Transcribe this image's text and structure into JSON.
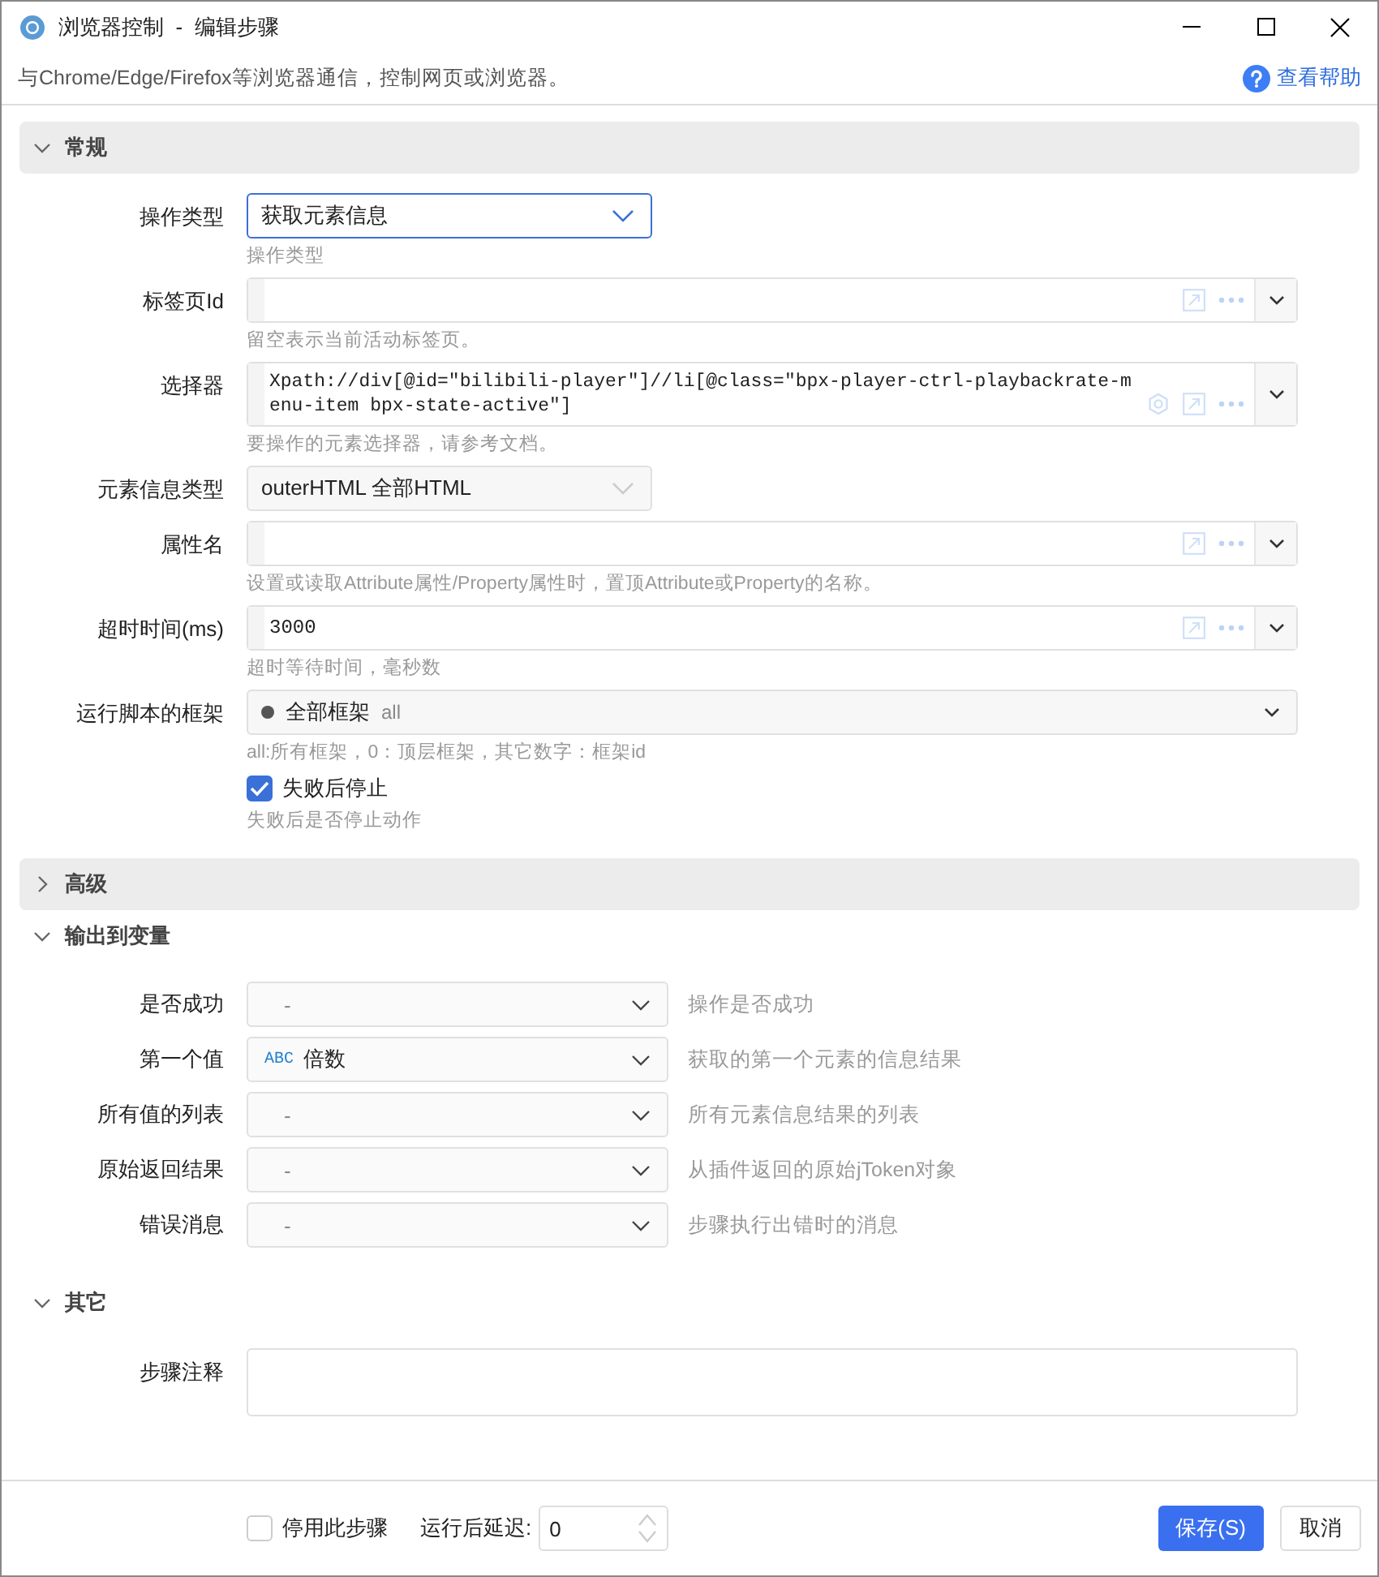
{
  "window": {
    "title": "浏览器控制  -  编辑步骤"
  },
  "description": "与Chrome/Edge/Firefox等浏览器通信，控制网页或浏览器。",
  "help_link": "查看帮助",
  "sections": [
    {
      "title": "常规",
      "kind": "panel",
      "expanded": true,
      "fields": [
        {
          "kind": "select",
          "label": "操作类型",
          "value": "获取元素信息",
          "focused": true,
          "hint": "操作类型"
        },
        {
          "kind": "combo",
          "label": "标签页Id",
          "picker": false,
          "hint": "留空表示当前活动标签页。"
        },
        {
          "kind": "combo",
          "label": "选择器",
          "value": "Xpath://div[@id=\"bilibili-player\"]//li[@class=\"bpx-player-ctrl-playbackrate-menu-item bpx-state-active\"]",
          "picker": true,
          "hint": "要操作的元素选择器，请参考文档。"
        },
        {
          "kind": "select",
          "label": "元素信息类型",
          "value": "outerHTML 全部HTML",
          "focused": false
        },
        {
          "kind": "combo",
          "label": "属性名",
          "picker": false,
          "hint": "设置或读取Attribute属性/Property属性时，置顶Attribute或Property的名称。"
        },
        {
          "kind": "combo",
          "label": "超时时间(ms)",
          "value": "3000",
          "picker": false,
          "hint": "超时等待时间，毫秒数"
        },
        {
          "kind": "frame",
          "label": "运行脚本的框架",
          "value": "全部框架",
          "detail": "all",
          "hint": "all:所有框架，0：顶层框架，其它数字：框架id"
        },
        {
          "kind": "checkbox",
          "label": "失败后停止",
          "checked": true,
          "hint": "失败后是否停止动作"
        }
      ]
    },
    {
      "title": "高级",
      "kind": "panel",
      "expanded": false
    },
    {
      "title": "输出到变量",
      "kind": "plain",
      "expanded": true,
      "outputs": [
        {
          "label": "是否成功",
          "value": "-",
          "hint": "操作是否成功"
        },
        {
          "label": "第一个值",
          "type_badge": "ABC",
          "value": "倍数",
          "hint": "获取的第一个元素的信息结果"
        },
        {
          "label": "所有值的列表",
          "value": "-",
          "hint": "所有元素信息结果的列表"
        },
        {
          "label": "原始返回结果",
          "value": "-",
          "hint": "从插件返回的原始jToken对象"
        },
        {
          "label": "错误消息",
          "value": "-",
          "hint": "步骤执行出错时的消息"
        }
      ]
    },
    {
      "title": "其它",
      "kind": "plain",
      "expanded": true,
      "fields": [
        {
          "kind": "textarea",
          "label": "步骤注释"
        }
      ]
    }
  ],
  "footer": {
    "disable": {
      "label": "停用此步骤",
      "checked": false
    },
    "delay": {
      "label": "运行后延迟:",
      "value": "0"
    },
    "save": "保存(S)",
    "cancel": "取消"
  }
}
